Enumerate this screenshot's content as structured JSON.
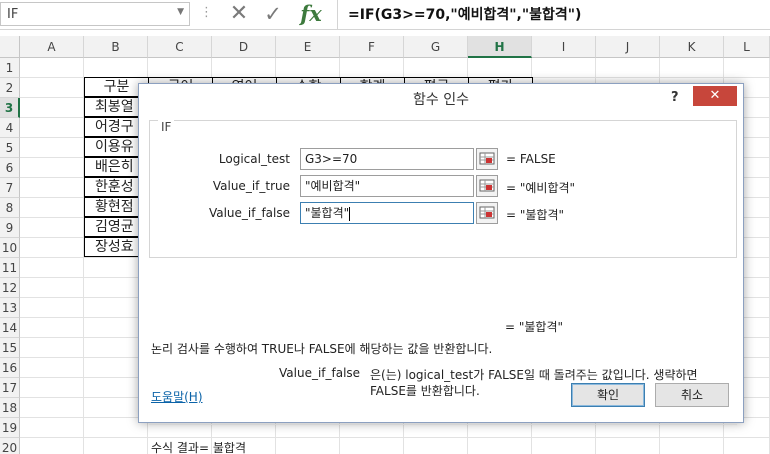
{
  "formula_bar": {
    "name_box": "IF",
    "cancel_icon": "close-icon",
    "enter_icon": "check-icon",
    "fx_label": "fx",
    "formula": "=IF(G3>=70,\"예비합격\",\"불합격\")"
  },
  "columns": [
    "A",
    "B",
    "C",
    "D",
    "E",
    "F",
    "G",
    "H",
    "I",
    "J",
    "K",
    "L"
  ],
  "selected_column": "H",
  "rows": [
    "1",
    "2",
    "3",
    "4",
    "5",
    "6",
    "7",
    "8",
    "9",
    "10",
    "11",
    "12",
    "13",
    "14",
    "15",
    "16",
    "17",
    "18",
    "19",
    "20"
  ],
  "selected_row": "3",
  "table": {
    "header": [
      "구분",
      "국어",
      "영어",
      "수학",
      "합계",
      "평균",
      "평가"
    ],
    "names": [
      "최봉열",
      "어경구",
      "이용유",
      "배은히",
      "한훈성",
      "황현점",
      "김영균",
      "장성효"
    ]
  },
  "dialog": {
    "title": "함수 인수",
    "help_glyph": "?",
    "close_glyph": "✕",
    "group_title": "IF",
    "args": [
      {
        "label": "Logical_test",
        "value": "G3>=70",
        "result": "=  FALSE"
      },
      {
        "label": "Value_if_true",
        "value": "\"예비합격\"",
        "result": "=  \"예비합격\""
      },
      {
        "label": "Value_if_false",
        "value": "\"불합격\"",
        "result": "=  \"불합격\""
      }
    ],
    "function_result": "=  \"불합격\"",
    "description": "논리 검사를 수행하여 TRUE나 FALSE에 해당하는 값을 반환합니다.",
    "arg_name": "Value_if_false",
    "arg_desc_line1": "은(는) logical_test가 FALSE일 때 돌려주는 값입니다. 생략하면",
    "arg_desc_line2": "FALSE를 반환합니다.",
    "formula_result_label": "수식 결과=",
    "formula_result_value": "불합격",
    "help_link": "도움말(H)",
    "ok_label": "확인",
    "cancel_label": "취소"
  }
}
